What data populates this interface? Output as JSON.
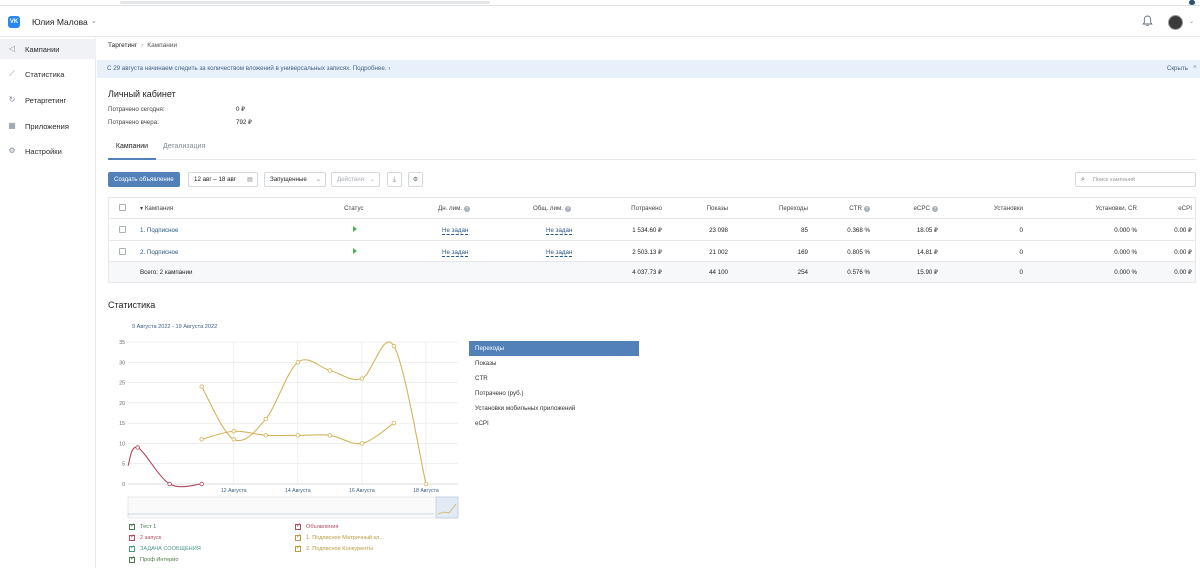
{
  "topbar": {
    "logo_text": "VK",
    "account_name": "Юлия Малова",
    "account_chevron": "⌄"
  },
  "sidebar": {
    "items": [
      {
        "label": "Кампании",
        "icon": "megaphone-icon",
        "glyph": "◁",
        "active": true
      },
      {
        "label": "Статистика",
        "icon": "chart-icon",
        "glyph": "⟋",
        "active": false
      },
      {
        "label": "Ретаргетинг",
        "icon": "retarget-icon",
        "glyph": "↻",
        "active": false
      },
      {
        "label": "Приложения",
        "icon": "apps-icon",
        "glyph": "▦",
        "active": false
      },
      {
        "label": "Настройки",
        "icon": "gear-icon",
        "glyph": "⚙",
        "active": false
      }
    ]
  },
  "breadcrumb": {
    "root": "Таргетинг",
    "sep": "›",
    "current": "Кампании"
  },
  "banner": {
    "text": "С 29 августа начинаем следить за количеством вложений в универсальных записях. Подробнее. ›",
    "hide_label": "Скрыть",
    "close": "×"
  },
  "cabinet": {
    "title": "Личный кабинет",
    "spent_today_label": "Потрачено сегодня:",
    "spent_today_value": "0 ₽",
    "spent_yesterday_label": "Потрачено вчера:",
    "spent_yesterday_value": "792 ₽"
  },
  "tabs": [
    "Кампании",
    "Детализация"
  ],
  "toolbar": {
    "create_label": "Создать объявление",
    "date_range": "12 авг – 18 авг",
    "filter_status": "Запущенные",
    "actions_label": "Действия",
    "search_placeholder": "Поиск кампаний"
  },
  "table": {
    "headers": {
      "campaign": "Кампания",
      "status": "Статус",
      "day_limit": "Дн. лим.",
      "total_limit": "Общ. лим.",
      "spent": "Потрачено",
      "impressions": "Показы",
      "clicks": "Переходы",
      "ctr": "CTR",
      "ecpc": "eCPC",
      "installs": "Установки",
      "installs_cr": "Установки, CR",
      "ecpi": "eCPI"
    },
    "rows": [
      {
        "name": "1. Подписное",
        "day_limit": "Не задан",
        "total_limit": "Не задан",
        "spent": "1 534.60 ₽",
        "impressions": "23 098",
        "clicks": "85",
        "ctr": "0.368 %",
        "ecpc": "18.05 ₽",
        "installs": "0",
        "installs_cr": "0.000 %",
        "ecpi": "0.00 ₽"
      },
      {
        "name": "2. Подписное",
        "day_limit": "Не задан",
        "total_limit": "Не задан",
        "spent": "2 503.13 ₽",
        "impressions": "21 002",
        "clicks": "169",
        "ctr": "0.805 %",
        "ecpc": "14.81 ₽",
        "installs": "0",
        "installs_cr": "0.000 %",
        "ecpi": "0.00 ₽"
      }
    ],
    "total": {
      "name": "Всего: 2 кампании",
      "spent": "4 037.73 ₽",
      "impressions": "44 100",
      "clicks": "254",
      "ctr": "0.576 %",
      "ecpc": "15.90 ₽",
      "installs": "0",
      "installs_cr": "0.000 %",
      "ecpi": "0.00 ₽"
    }
  },
  "stats": {
    "title": "Статистика",
    "range_label": "9 Августа 2022 - 19 Августа 2022",
    "metrics": [
      "Переходы",
      "Показы",
      "CTR",
      "Потрачено (руб.)",
      "Установки мобильных приложений",
      "eCPI"
    ],
    "active_metric": "Переходы"
  },
  "chart_data": {
    "type": "line",
    "x_ticks": [
      "12 Августа",
      "14 Августа",
      "16 Августа",
      "18 Августа"
    ],
    "y_ticks": [
      0,
      5,
      10,
      15,
      20,
      25,
      30,
      35
    ],
    "ylim": [
      0,
      35
    ],
    "grid": true,
    "x_days": [
      8.7,
      9,
      10,
      11,
      12,
      13,
      14,
      15,
      16,
      17,
      18,
      19
    ],
    "series": [
      {
        "name": "2 запуск",
        "color": "#b5485a",
        "points": [
          [
            8.7,
            4.5
          ],
          [
            9,
            9
          ],
          [
            10,
            0
          ],
          [
            11,
            0
          ]
        ]
      },
      {
        "name": "1. Подписное Матричный кл...",
        "color": "#d2b45c",
        "points": [
          [
            11,
            24
          ],
          [
            12,
            11
          ],
          [
            13,
            16
          ],
          [
            14,
            30
          ],
          [
            15,
            28
          ],
          [
            16,
            26
          ],
          [
            17,
            34
          ],
          [
            18,
            0
          ]
        ]
      },
      {
        "name": "2. Подписное Конкуренты",
        "color": "#d2b45c",
        "points": [
          [
            11,
            11
          ],
          [
            12,
            13
          ],
          [
            13,
            12
          ],
          [
            14,
            12
          ],
          [
            15,
            12
          ],
          [
            16,
            10
          ],
          [
            17,
            15
          ]
        ]
      }
    ]
  },
  "legend": [
    {
      "label": "Тест 1",
      "color": "#4a7a4a"
    },
    {
      "label": "2 запуск",
      "color": "#b5485a"
    },
    {
      "label": "ЗАДАЧА СООБЩЕНИЯ",
      "color": "#4a9a8a"
    },
    {
      "label": "Проф Интерио",
      "color": "#4a7a4a"
    },
    {
      "label": "Объявления",
      "color": "#b5485a"
    },
    {
      "label": "1. Подписное Матричный кл...",
      "color": "#b89a40"
    },
    {
      "label": "2. Подписное Конкуренты",
      "color": "#b89a40"
    }
  ]
}
